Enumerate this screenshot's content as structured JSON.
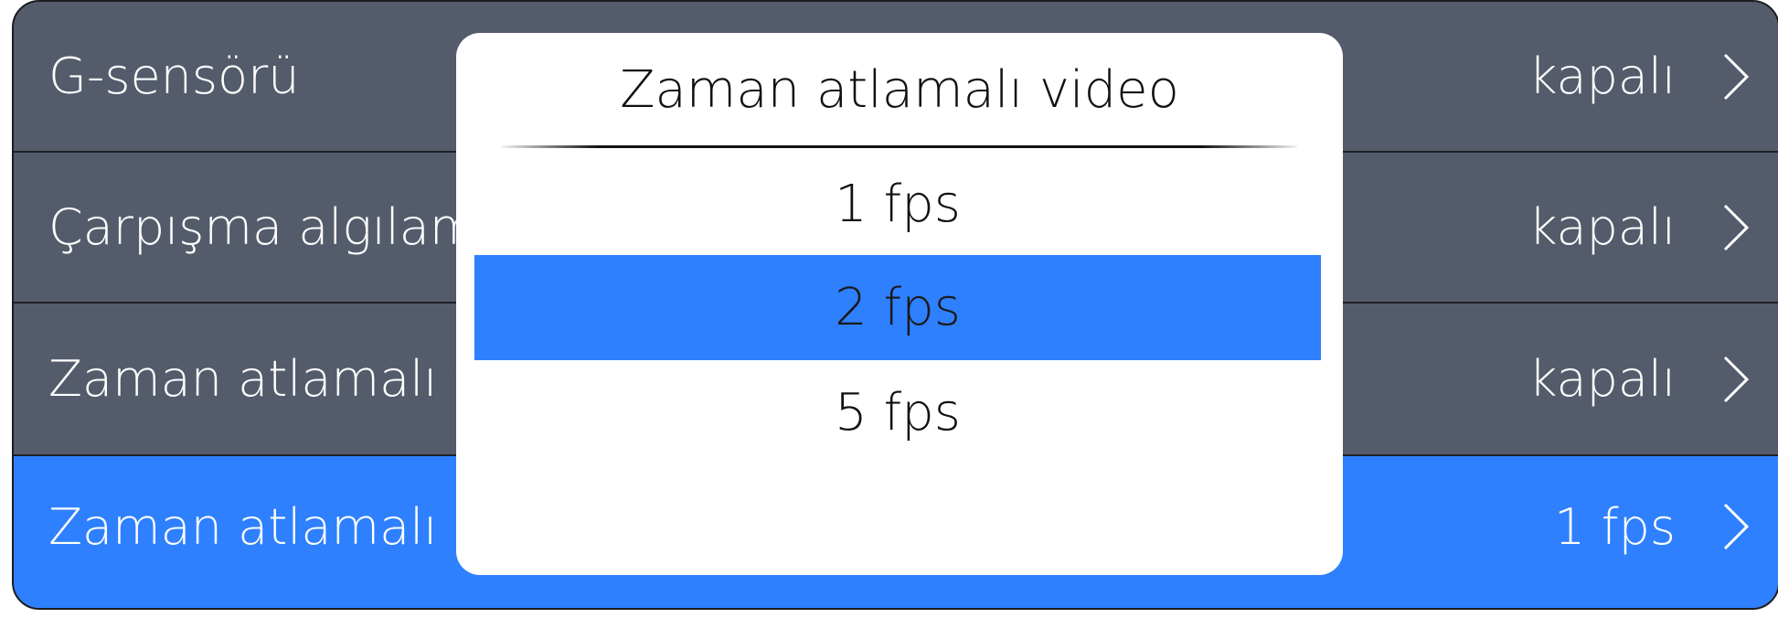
{
  "colors": {
    "row_background": "#545c6b",
    "selected_background": "#2e80fe",
    "dialog_background": "#ffffff"
  },
  "settings": {
    "rows": [
      {
        "label": "G-sensörü",
        "value": "kapalı"
      },
      {
        "label": "Çarpışma algılama",
        "value": "kapalı"
      },
      {
        "label": "Zaman atlamalı video",
        "value": "kapalı"
      },
      {
        "label": "Zaman atlamalı video",
        "value": "1 fps"
      }
    ]
  },
  "dialog": {
    "title": "Zaman atlamalı video",
    "options": [
      {
        "label": "1 fps"
      },
      {
        "label": "2 fps"
      },
      {
        "label": "5 fps"
      }
    ],
    "selected_option": "2 fps"
  }
}
